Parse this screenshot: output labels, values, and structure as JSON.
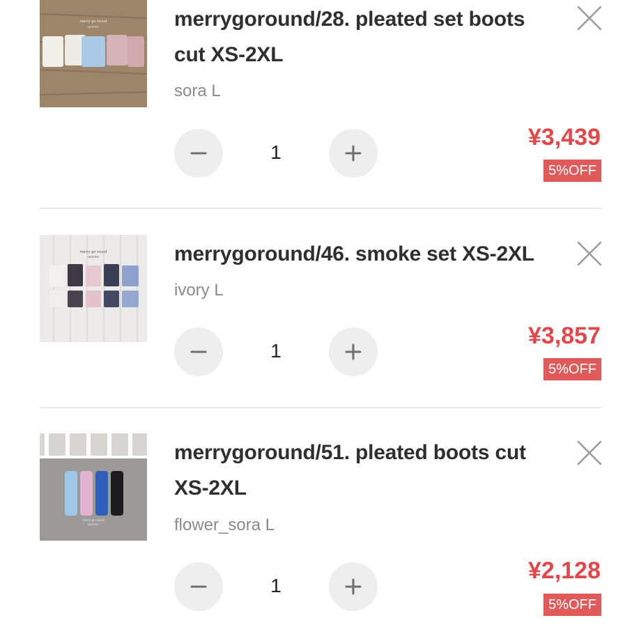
{
  "cart": {
    "items": [
      {
        "title_line1": "merrygoround/28. pleated set boots",
        "title_line2": "cut XS-2XL",
        "variant": "sora L",
        "quantity": "1",
        "price": "¥3,439",
        "discount": "5%OFF",
        "thumbnail_text": [
          "merry go round",
          "summer"
        ]
      },
      {
        "title_line1": "merrygoround/46. smoke set XS-2XL",
        "title_line2": "",
        "variant": "ivory L",
        "quantity": "1",
        "price": "¥3,857",
        "discount": "5%OFF",
        "thumbnail_text": [
          "merry go round",
          "summer"
        ]
      },
      {
        "title_line1": "merrygoround/51. pleated boots cut",
        "title_line2": "XS-2XL",
        "variant": "flower_sora L",
        "quantity": "1",
        "price": "¥2,128",
        "discount": "5%OFF",
        "thumbnail_text": [
          "merry go round",
          "summer"
        ]
      }
    ]
  },
  "icons": {
    "remove": "close-icon",
    "decrement": "minus-icon",
    "increment": "plus-icon"
  },
  "colors": {
    "price": "#e2474b",
    "badge": "#e05a5a",
    "button_bg": "#eeeeee"
  }
}
